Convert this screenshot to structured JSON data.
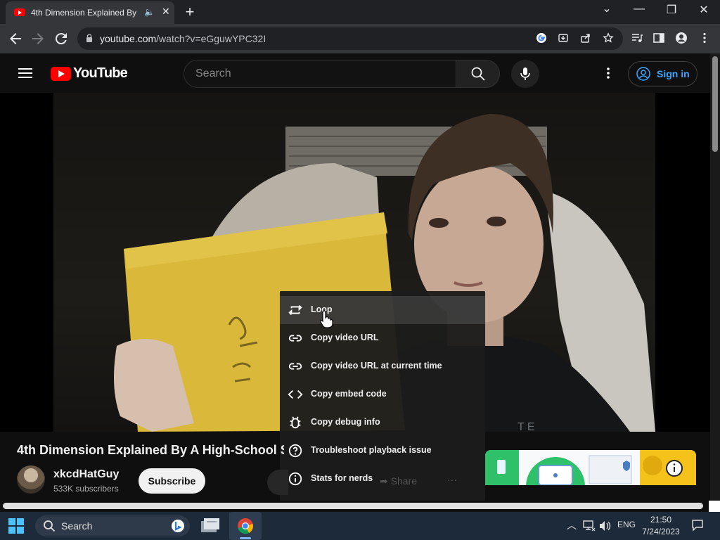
{
  "browser": {
    "tab_title": "4th Dimension Explained By",
    "url_host": "youtube.com",
    "url_path": "/watch?v=eGguwYPC32I",
    "new_tab_glyph": "+",
    "close_glyph": "✕",
    "minimize_glyph": "—",
    "restore_glyph": "❐",
    "dropdown_glyph": "⌄"
  },
  "youtube": {
    "logo_text": "YouTube",
    "search_placeholder": "Search",
    "sign_in_label": "Sign in"
  },
  "video": {
    "title": "4th Dimension Explained By A High-School S",
    "channel_name": "xkcdHatGuy",
    "subscribers": "533K subscribers",
    "subscribe_label": "Subscribe",
    "share_label": "Share",
    "more_label": "···"
  },
  "context_menu": {
    "items": [
      {
        "label": "Loop",
        "icon": "loop-icon"
      },
      {
        "label": "Copy video URL",
        "icon": "link-icon"
      },
      {
        "label": "Copy video URL at current time",
        "icon": "link-icon"
      },
      {
        "label": "Copy embed code",
        "icon": "code-icon"
      },
      {
        "label": "Copy debug info",
        "icon": "bug-icon"
      },
      {
        "label": "Troubleshoot playback issue",
        "icon": "help-icon"
      },
      {
        "label": "Stats for nerds",
        "icon": "info-icon"
      }
    ]
  },
  "taskbar": {
    "search_label": "Search",
    "language": "ENG",
    "time": "21:50",
    "date": "7/24/2023"
  },
  "colors": {
    "youtube_red": "#ff0000",
    "link_blue": "#3ea6ff",
    "chrome_dark": "#202124",
    "chrome_toolbar": "#35363a"
  }
}
